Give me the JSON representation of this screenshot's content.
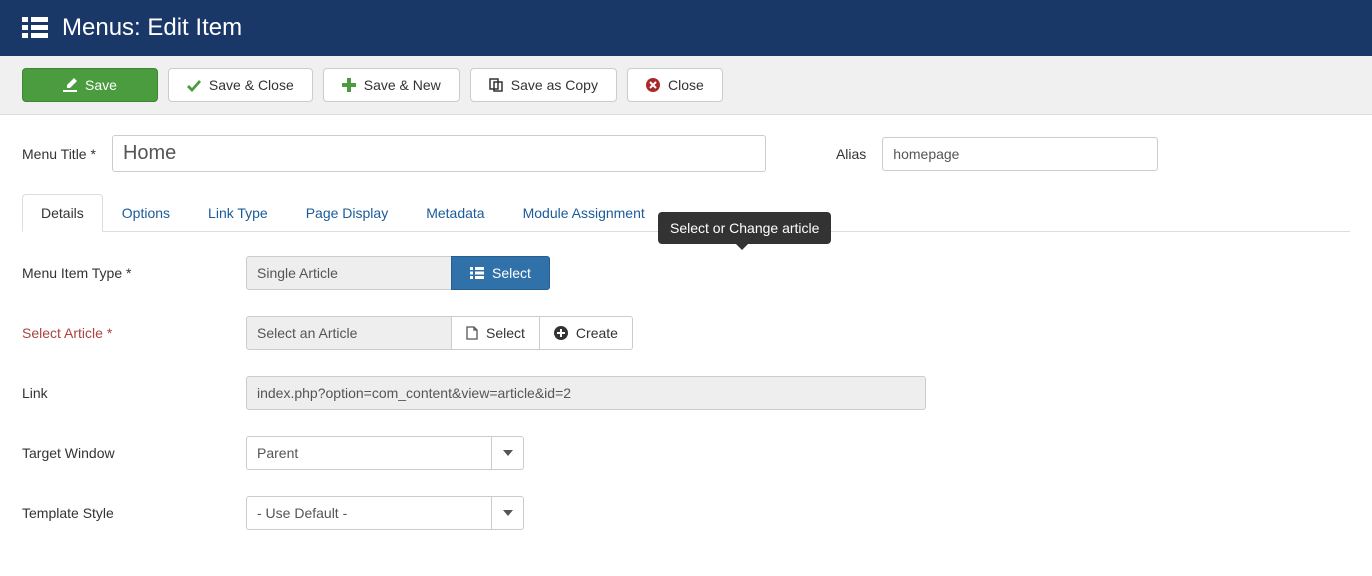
{
  "header": {
    "title": "Menus: Edit Item"
  },
  "toolbar": {
    "save": "Save",
    "save_close": "Save & Close",
    "save_new": "Save & New",
    "save_copy": "Save as Copy",
    "close": "Close"
  },
  "form": {
    "menu_title_label": "Menu Title",
    "menu_title_value": "Home",
    "alias_label": "Alias",
    "alias_value": "homepage"
  },
  "tabs": [
    {
      "label": "Details",
      "active": true
    },
    {
      "label": "Options",
      "active": false
    },
    {
      "label": "Link Type",
      "active": false
    },
    {
      "label": "Page Display",
      "active": false
    },
    {
      "label": "Metadata",
      "active": false
    },
    {
      "label": "Module Assignment",
      "active": false
    }
  ],
  "fields": {
    "menu_item_type_label": "Menu Item Type",
    "menu_item_type_value": "Single Article",
    "menu_item_type_select": "Select",
    "select_article_label": "Select Article",
    "select_article_value": "Select an Article",
    "select_btn": "Select",
    "create_btn": "Create",
    "tooltip": "Select or Change article",
    "link_label": "Link",
    "link_value": "index.php?option=com_content&view=article&id=2",
    "target_window_label": "Target Window",
    "target_window_value": "Parent",
    "template_style_label": "Template Style",
    "template_style_value": "- Use Default -"
  }
}
